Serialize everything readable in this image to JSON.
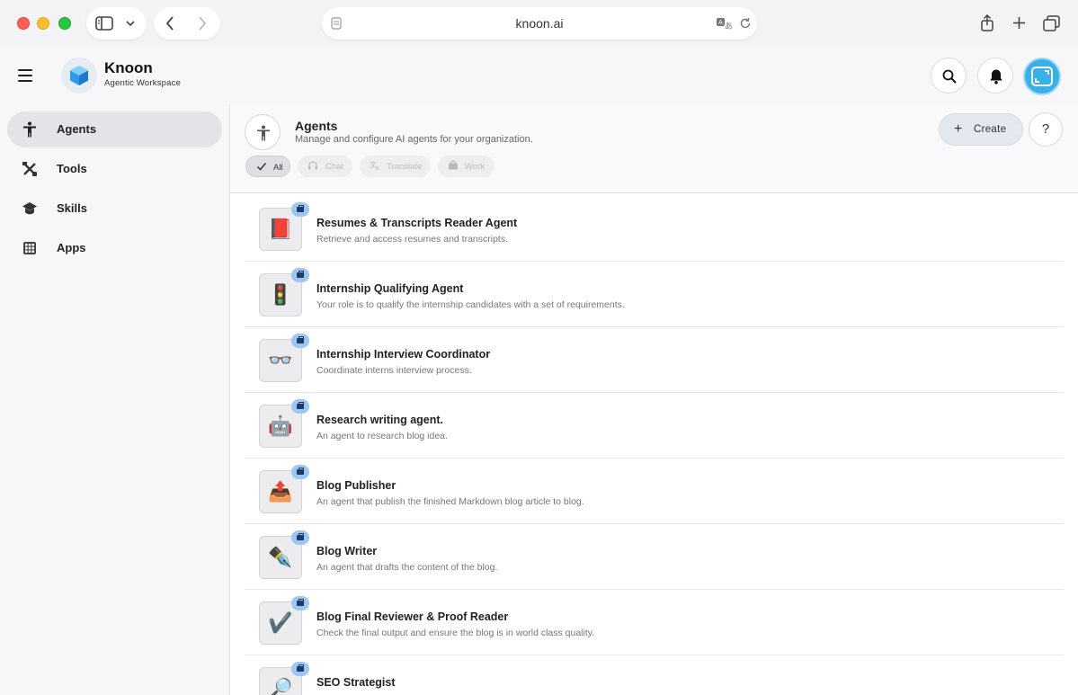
{
  "browser": {
    "url": "knoon.ai"
  },
  "app": {
    "brand_name": "Knoon",
    "brand_subtitle": "Agentic Workspace"
  },
  "sidebar": {
    "items": [
      {
        "label": "Agents",
        "icon": "person-icon",
        "active": true
      },
      {
        "label": "Tools",
        "icon": "tools-icon",
        "active": false
      },
      {
        "label": "Skills",
        "icon": "graduation-cap-icon",
        "active": false
      },
      {
        "label": "Apps",
        "icon": "grid-icon",
        "active": false
      }
    ]
  },
  "page": {
    "title": "Agents",
    "subtitle": "Manage and configure AI agents for your organization.",
    "create_label": "Create",
    "help_label": "?",
    "filters": [
      {
        "label": "All",
        "icon": "check-icon",
        "active": true
      },
      {
        "label": "Chat",
        "icon": "headset-icon",
        "active": false
      },
      {
        "label": "Translate",
        "icon": "translate-icon",
        "active": false
      },
      {
        "label": "Work",
        "icon": "briefcase-icon",
        "active": false
      }
    ]
  },
  "agents": [
    {
      "name": "Resumes & Transcripts Reader Agent",
      "description": "Retrieve and access resumes and transcripts.",
      "emoji": "📕"
    },
    {
      "name": "Internship Qualifying Agent",
      "description": "Your role is to qualify the internship candidates with a set of requirements.",
      "emoji": "🚦"
    },
    {
      "name": "Internship Interview Coordinator",
      "description": "Coordinate interns interview process.",
      "emoji": "👓"
    },
    {
      "name": "Research writing agent.",
      "description": "An agent to research blog idea.",
      "emoji": "🤖"
    },
    {
      "name": "Blog Publisher",
      "description": "An agent that publish the finished Markdown blog article to blog.",
      "emoji": "📤"
    },
    {
      "name": "Blog Writer",
      "description": "An agent that drafts the content of the blog.",
      "emoji": "✒️"
    },
    {
      "name": "Blog Final Reviewer & Proof Reader",
      "description": "Check the final output and ensure the blog is in world class quality.",
      "emoji": "✔️"
    },
    {
      "name": "SEO Strategist",
      "description": "",
      "emoji": "🔎"
    }
  ],
  "colors": {
    "accent": "#3ab0e8",
    "badge": "#9cc7f2",
    "active_nav": "#e3e4e8"
  }
}
